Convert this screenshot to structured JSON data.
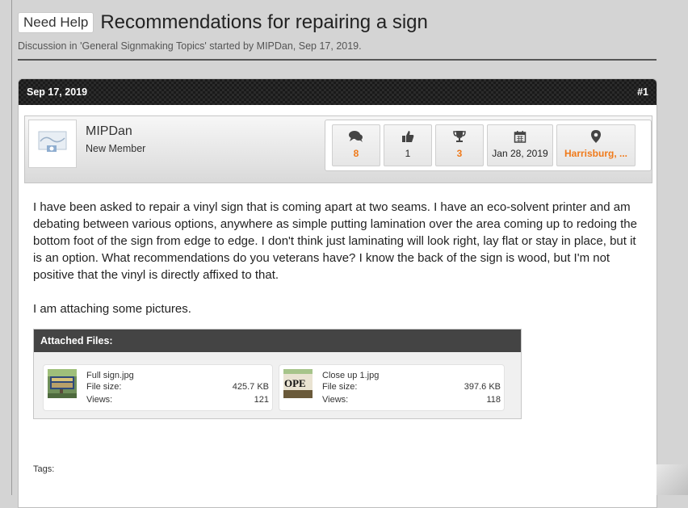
{
  "thread": {
    "prefix": "Need Help",
    "title": "Recommendations for repairing a sign",
    "meta": "Discussion in 'General Signmaking Topics' started by MIPDan, Sep 17, 2019."
  },
  "post": {
    "date": "Sep 17, 2019",
    "number": "#1",
    "user": {
      "name": "MIPDan",
      "title": "New Member"
    },
    "stats": [
      {
        "icon": "messages-icon",
        "value": "8",
        "highlight": true
      },
      {
        "icon": "thumbs-up-icon",
        "value": "1",
        "highlight": false
      },
      {
        "icon": "trophy-icon",
        "value": "3",
        "highlight": true
      },
      {
        "icon": "calendar-icon",
        "value": "Jan 28, 2019",
        "highlight": false
      },
      {
        "icon": "location-pin-icon",
        "value": "Harrisburg, ...",
        "highlight": true
      }
    ],
    "body": [
      "I have been asked to repair a vinyl sign that is coming apart at two seams. I have an eco-solvent printer and am debating between various options, anywhere as simple putting lamination over the area coming up to redoing the bottom foot of the sign from edge to edge. I don't think just laminating will look right, lay flat or stay in place, but it is an option. What recommendations do you veterans have? I know the back of the sign is wood, but I'm not positive that the vinyl is directly affixed to that.",
      "I am attaching some pictures."
    ],
    "attachments": {
      "header": "Attached Files:",
      "files": [
        {
          "name": "Full sign.jpg",
          "size_label": "File size:",
          "size": "425.7 KB",
          "views_label": "Views:",
          "views": "121"
        },
        {
          "name": "Close up 1.jpg",
          "size_label": "File size:",
          "size": "397.6 KB",
          "views_label": "Views:",
          "views": "118",
          "thumb_text": "OPE"
        }
      ]
    },
    "tags_label": "Tags:"
  },
  "colors": {
    "accent": "#f07a1a",
    "header_dark": "#2b2b2b",
    "attach_header": "#444444"
  }
}
